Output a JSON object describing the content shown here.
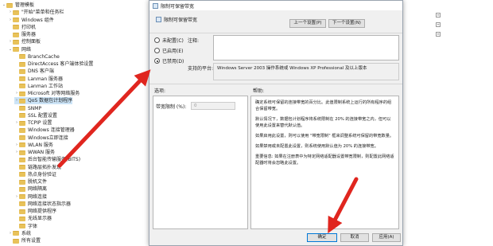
{
  "tree": {
    "items": [
      {
        "label": "管理模板",
        "indent": 0,
        "caret": "⌄",
        "selected": false
      },
      {
        "label": "\"开始\"菜单和任务栏",
        "indent": 1,
        "caret": "›",
        "selected": false
      },
      {
        "label": "Windows 组件",
        "indent": 1,
        "caret": "›",
        "selected": false
      },
      {
        "label": "打印机",
        "indent": 1,
        "caret": "",
        "selected": false
      },
      {
        "label": "服务器",
        "indent": 1,
        "caret": "",
        "selected": false
      },
      {
        "label": "控制面板",
        "indent": 1,
        "caret": "›",
        "selected": false
      },
      {
        "label": "网络",
        "indent": 1,
        "caret": "⌄",
        "selected": false
      },
      {
        "label": "BranchCache",
        "indent": 2,
        "caret": "",
        "selected": false
      },
      {
        "label": "DirectAccess 客户端体验设置",
        "indent": 2,
        "caret": "",
        "selected": false
      },
      {
        "label": "DNS 客户端",
        "indent": 2,
        "caret": "",
        "selected": false
      },
      {
        "label": "Lanman 服务器",
        "indent": 2,
        "caret": "",
        "selected": false
      },
      {
        "label": "Lanman 工作站",
        "indent": 2,
        "caret": "",
        "selected": false
      },
      {
        "label": "Microsoft 对等网络服务",
        "indent": 2,
        "caret": "›",
        "selected": false
      },
      {
        "label": "QoS 数据包计划程序",
        "indent": 2,
        "caret": "›",
        "selected": true
      },
      {
        "label": "SNMP",
        "indent": 2,
        "caret": "",
        "selected": false
      },
      {
        "label": "SSL 配置设置",
        "indent": 2,
        "caret": "",
        "selected": false
      },
      {
        "label": "TCPIP 设置",
        "indent": 2,
        "caret": "›",
        "selected": false
      },
      {
        "label": "Windows 连接管理器",
        "indent": 2,
        "caret": "",
        "selected": false
      },
      {
        "label": "Windows立即连接",
        "indent": 2,
        "caret": "",
        "selected": false
      },
      {
        "label": "WLAN 服务",
        "indent": 2,
        "caret": "›",
        "selected": false
      },
      {
        "label": "WWAN 服务",
        "indent": 2,
        "caret": "›",
        "selected": false
      },
      {
        "label": "后台智能传输服务(BITS)",
        "indent": 2,
        "caret": "",
        "selected": false
      },
      {
        "label": "链路层拓扑发现",
        "indent": 2,
        "caret": "",
        "selected": false
      },
      {
        "label": "热点身份验证",
        "indent": 2,
        "caret": "",
        "selected": false
      },
      {
        "label": "脱机文件",
        "indent": 2,
        "caret": "",
        "selected": false
      },
      {
        "label": "网络隔离",
        "indent": 2,
        "caret": "",
        "selected": false
      },
      {
        "label": "网络连接",
        "indent": 2,
        "caret": "›",
        "selected": false
      },
      {
        "label": "网络连接状态指示器",
        "indent": 2,
        "caret": "",
        "selected": false
      },
      {
        "label": "网络提供程序",
        "indent": 2,
        "caret": "",
        "selected": false
      },
      {
        "label": "无线显示器",
        "indent": 2,
        "caret": "",
        "selected": false
      },
      {
        "label": "字体",
        "indent": 2,
        "caret": "",
        "selected": false
      },
      {
        "label": "系统",
        "indent": 1,
        "caret": "›",
        "selected": false
      },
      {
        "label": "所有设置",
        "indent": 1,
        "caret": "",
        "selected": false
      }
    ]
  },
  "dialog": {
    "window_title": "限制可保留带宽",
    "header_title": "限制可保留带宽",
    "prev_button": "上一个设置(P)",
    "next_button": "下一个设置(N)",
    "radio_not_configured": "未配置(C)",
    "radio_enabled": "已启用(E)",
    "radio_disabled": "已禁用(D)",
    "selected_radio": "disabled",
    "comment_label": "注释:",
    "supported_label": "支持的平台:",
    "supported_value": "Windows Server 2003 操作系统或 Windows XP Professional 及以上版本",
    "options_label": "选项:",
    "help_label": "帮助:",
    "bandwidth_label": "带宽限制 (%):",
    "bandwidth_value": "0",
    "help_paragraphs": [
      "确定系统可保留的连接带宽的百分比。此值限制系统上运行的所有程序的组合保留带宽。",
      "默认情况下，数据包计划程序将系统限制在 20% 的连接带宽之内，但可以使用此设置来替代默认值。",
      "如果启用此设置，则可以使用 \"带宽限制\" 框来调整系统可保留的带宽数量。",
      "如果禁用或未配置此设置，则系统使用默认值为 20% 的连接带宽。",
      "重要信息: 如果在注册表中为特定网络适配器设置带宽限制，则配置此网络适配器时将会忽略此设置。"
    ],
    "ok_button": "确定",
    "cancel_button": "取消",
    "apply_button": "应用(A)"
  },
  "colors": {
    "arrow": "#e0261f",
    "selection": "#cce4f7",
    "dialog_bg": "#f0f0f0"
  }
}
